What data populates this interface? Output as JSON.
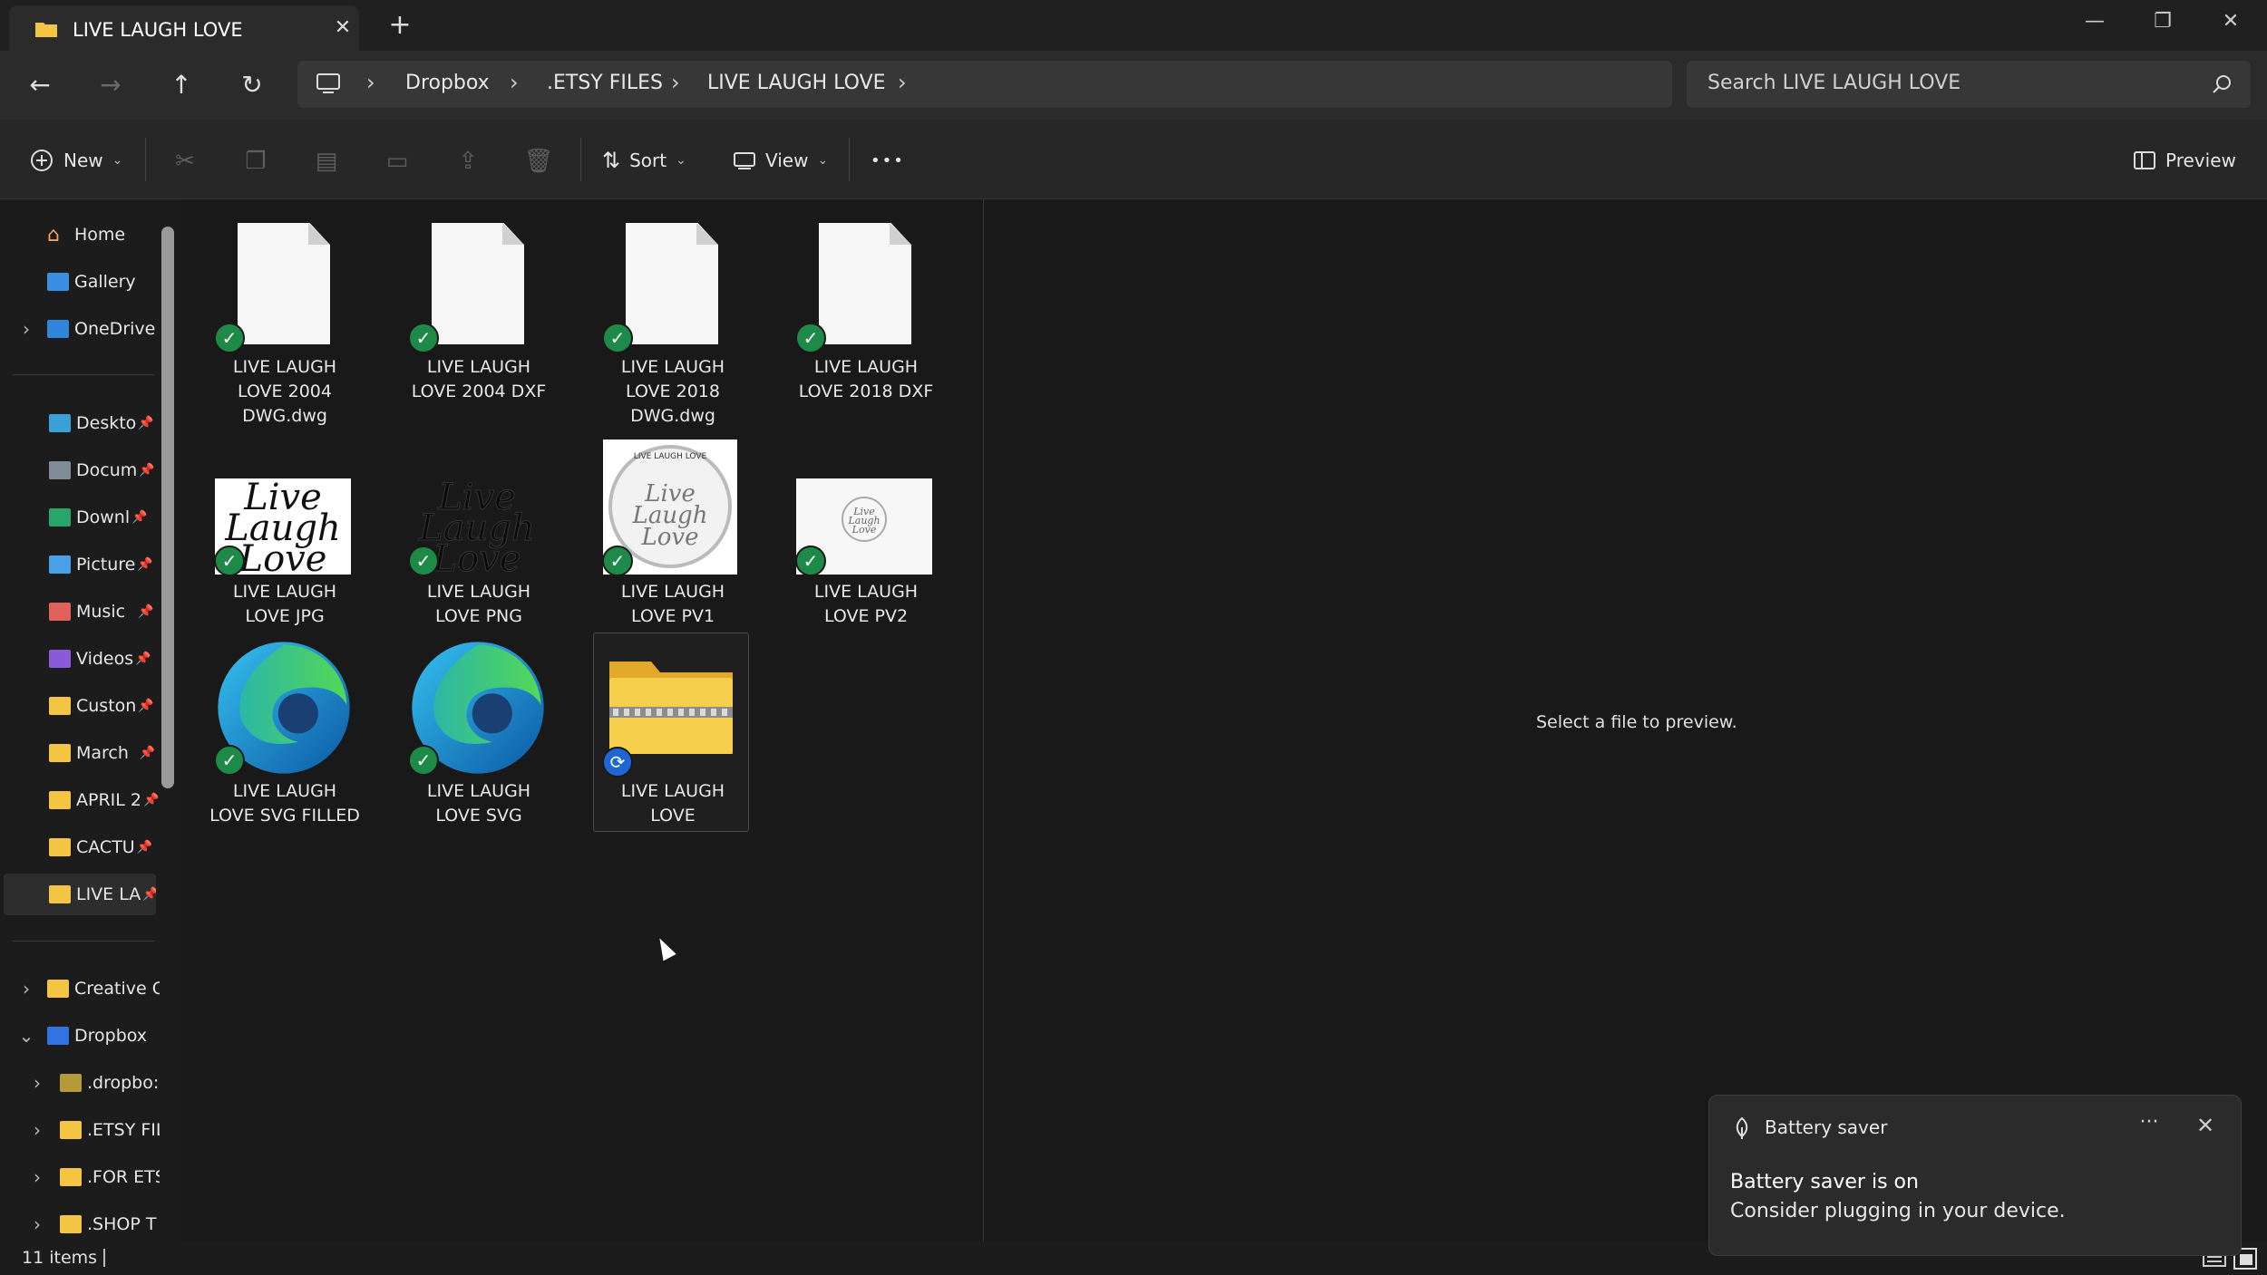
{
  "window": {
    "tab_title": "LIVE LAUGH LOVE",
    "tab_close": "✕",
    "tab_add": "+",
    "minimize": "—",
    "maximize": "❐",
    "close": "✕"
  },
  "nav": {
    "back": "←",
    "forward": "→",
    "up": "↑",
    "refresh": "↻",
    "chevron": "›",
    "breadcrumbs": [
      "Dropbox",
      ".ETSY FILES",
      "LIVE LAUGH LOVE"
    ],
    "search_placeholder": "Search LIVE LAUGH LOVE"
  },
  "commandbar": {
    "new_label": "New",
    "sort_label": "Sort",
    "view_label": "View",
    "more_label": "•••",
    "preview_label": "Preview",
    "dropdown": "⌄"
  },
  "sidebar": {
    "pin": "📌",
    "expand": "›",
    "collapse": "⌄",
    "top": [
      "Home",
      "Gallery",
      "OneDrive"
    ],
    "quick_access": [
      "Deskto",
      "Docum",
      "Downl",
      "Picture",
      "Music",
      "Videos",
      "Custon",
      "March",
      "APRIL 2",
      "CACTU",
      "LIVE LA"
    ],
    "tree": [
      "Creative C",
      "Dropbox",
      ".dropbo:",
      ".ETSY FIL",
      ".FOR ETS",
      ".SHOP T"
    ]
  },
  "files": [
    {
      "line1": "LIVE LAUGH",
      "line2": "LOVE 2004",
      "line3": "DWG.dwg"
    },
    {
      "line1": "LIVE LAUGH",
      "line2": "LOVE 2004 DXF",
      "line3": ""
    },
    {
      "line1": "LIVE LAUGH",
      "line2": "LOVE 2018",
      "line3": "DWG.dwg"
    },
    {
      "line1": "LIVE LAUGH",
      "line2": "LOVE 2018 DXF",
      "line3": ""
    },
    {
      "line1": "LIVE LAUGH",
      "line2": "LOVE JPG",
      "line3": ""
    },
    {
      "line1": "LIVE LAUGH",
      "line2": "LOVE PNG",
      "line3": ""
    },
    {
      "line1": "LIVE LAUGH",
      "line2": "LOVE PV1",
      "line3": ""
    },
    {
      "line1": "LIVE LAUGH",
      "line2": "LOVE PV2",
      "line3": ""
    },
    {
      "line1": "LIVE LAUGH",
      "line2": "LOVE SVG FILLED",
      "line3": ""
    },
    {
      "line1": "LIVE LAUGH",
      "line2": "LOVE SVG",
      "line3": ""
    },
    {
      "line1": "LIVE LAUGH",
      "line2": "LOVE",
      "line3": ""
    }
  ],
  "thumb_art": {
    "script_text": "Live Laugh Love",
    "pv1_header": "LIVE LAUGH LOVE"
  },
  "badges": {
    "check": "✓",
    "sync": "⟳"
  },
  "preview": {
    "message": "Select a file to preview."
  },
  "status": {
    "items": "11 items"
  },
  "toast": {
    "app": "Battery saver",
    "title": "Battery saver is on",
    "body": "Consider plugging in your device.",
    "more": "···",
    "close": "✕"
  },
  "colors": {
    "folder": "#f4c542",
    "check": "#1e8a47",
    "sync": "#1f66d4",
    "accent": "#4ea1f3"
  }
}
